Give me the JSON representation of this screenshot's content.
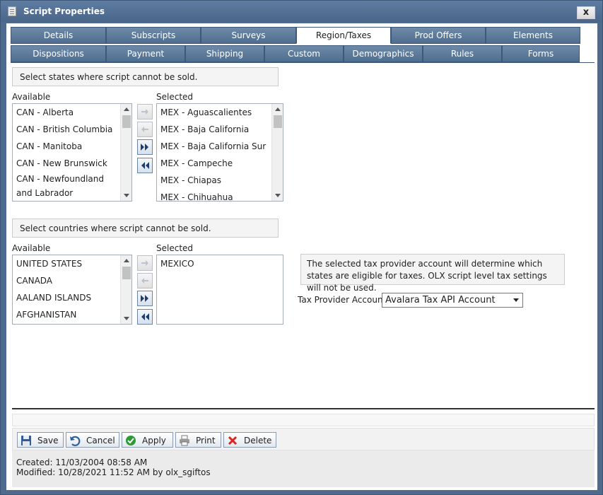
{
  "window": {
    "title": "Script Properties",
    "close": "x"
  },
  "tabs_row1": [
    {
      "label": "Details"
    },
    {
      "label": "Subscripts"
    },
    {
      "label": "Surveys"
    },
    {
      "label": "Region/Taxes",
      "active": true
    },
    {
      "label": "Prod Offers"
    },
    {
      "label": "Elements"
    }
  ],
  "tabs_row2": [
    {
      "label": "Dispositions"
    },
    {
      "label": "Payment"
    },
    {
      "label": "Shipping"
    },
    {
      "label": "Custom"
    },
    {
      "label": "Demographics"
    },
    {
      "label": "Rules"
    },
    {
      "label": "Forms"
    }
  ],
  "states": {
    "note": "Select states where script cannot be sold.",
    "available_label": "Available",
    "selected_label": "Selected",
    "available": [
      "CAN - Alberta",
      "CAN - British Columbia",
      "CAN - Manitoba",
      "CAN - New Brunswick",
      "CAN - Newfoundland and Labrador"
    ],
    "selected": [
      "MEX - Aguascalientes",
      "MEX - Baja California",
      "MEX - Baja California Sur",
      "MEX - Campeche",
      "MEX - Chiapas",
      "MEX - Chihuahua"
    ]
  },
  "countries": {
    "note": "Select countries where script cannot be sold.",
    "available_label": "Available",
    "selected_label": "Selected",
    "available": [
      "UNITED STATES",
      "CANADA",
      "AALAND ISLANDS",
      "AFGHANISTAN"
    ],
    "selected": [
      "MEXICO"
    ]
  },
  "tax": {
    "note": "The selected tax provider account will determine which states are eligible for taxes. OLX script level tax settings will not be used.",
    "provider_label": "Tax Provider Account",
    "provider_value": "Avalara Tax API Account"
  },
  "toolbar": {
    "save": "Save",
    "cancel": "Cancel",
    "apply": "Apply",
    "print": "Print",
    "delete": "Delete"
  },
  "meta": {
    "created": "Created: 11/03/2004 08:58 AM",
    "modified": "Modified: 10/28/2021 11:52 AM by olx_sgiftos"
  },
  "colors": {
    "tab_bg": "#4f6d8f",
    "frame": "#4e6a8c",
    "accent_arrow": "#1c3d6e"
  }
}
